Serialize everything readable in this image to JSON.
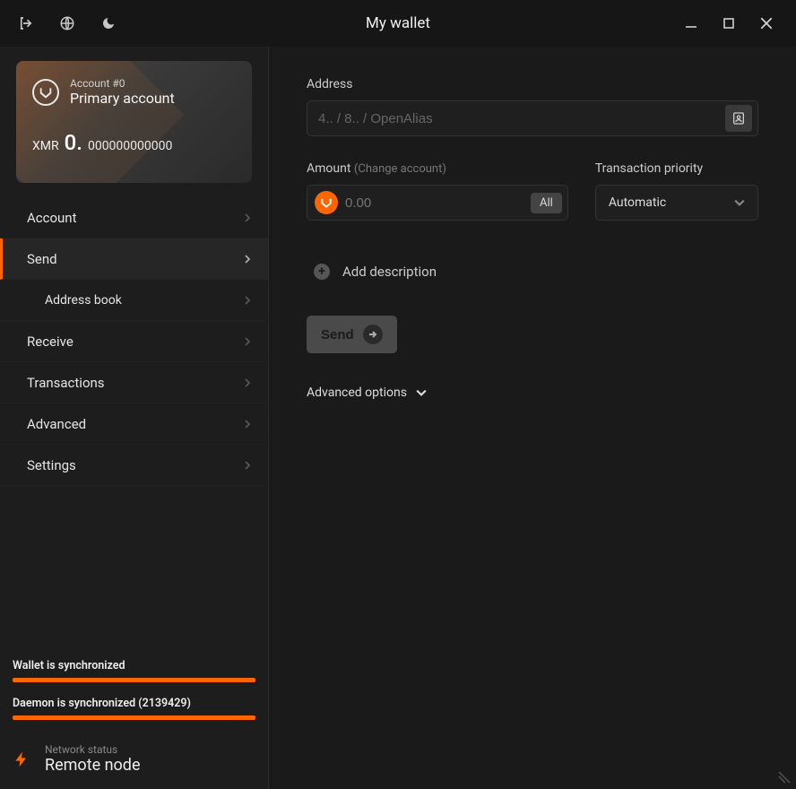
{
  "title": "My wallet",
  "account": {
    "number": "Account #0",
    "name": "Primary account",
    "currency": "XMR",
    "balance_big": "0.",
    "balance_small": "000000000000"
  },
  "sidebar": {
    "items": [
      {
        "label": "Account"
      },
      {
        "label": "Send"
      },
      {
        "label": "Address book"
      },
      {
        "label": "Receive"
      },
      {
        "label": "Transactions"
      },
      {
        "label": "Advanced"
      },
      {
        "label": "Settings"
      }
    ]
  },
  "sync": {
    "wallet_label": "Wallet is synchronized",
    "daemon_label": "Daemon is synchronized (2139429)"
  },
  "network": {
    "caption": "Network status",
    "value": "Remote node"
  },
  "send": {
    "address_label": "Address",
    "address_placeholder": "4.. / 8.. / OpenAlias",
    "amount_label": "Amount",
    "amount_sub": "(Change account)",
    "amount_placeholder": "0.00",
    "all_btn": "All",
    "priority_label": "Transaction priority",
    "priority_value": "Automatic",
    "add_desc": "Add description",
    "send_btn": "Send",
    "adv_opts": "Advanced options"
  }
}
